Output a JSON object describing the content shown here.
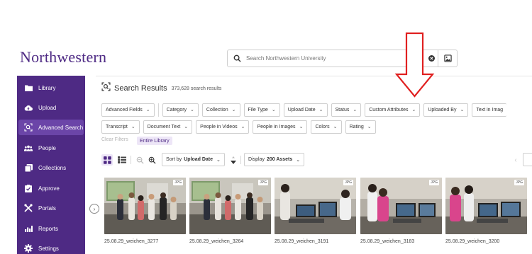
{
  "header": {
    "logo": "Northwestern",
    "search_placeholder": "Search Northwestern University"
  },
  "sidebar": {
    "items": [
      {
        "label": "Library",
        "icon": "folder-icon"
      },
      {
        "label": "Upload",
        "icon": "cloud-upload-icon"
      },
      {
        "label": "Advanced Search",
        "icon": "advanced-search-icon",
        "active": true
      },
      {
        "label": "People",
        "icon": "people-icon"
      },
      {
        "label": "Collections",
        "icon": "collections-icon"
      },
      {
        "label": "Approve",
        "icon": "approve-icon"
      },
      {
        "label": "Portals",
        "icon": "portals-icon"
      },
      {
        "label": "Reports",
        "icon": "reports-icon"
      },
      {
        "label": "Settings",
        "icon": "settings-icon"
      }
    ]
  },
  "results": {
    "title": "Search Results",
    "count": "373,628 search results"
  },
  "filters_row1": [
    "Advanced Fields",
    "Category",
    "Collection",
    "File Type",
    "Upload Date",
    "Status",
    "Custom Attributes",
    "Uploaded By",
    "Text in Imag"
  ],
  "filters_row2": [
    "Transcript",
    "Document Text",
    "People in Videos",
    "People in Images",
    "Colors",
    "Rating"
  ],
  "active_filters": {
    "clear_label": "Clear Filters",
    "chip": "Entire Library"
  },
  "toolbar": {
    "sort_prefix": "Sort by",
    "sort_value": "Upload Date",
    "display_prefix": "Display",
    "display_value": "200 Assets"
  },
  "assets": [
    {
      "name": "25.08.29_weichen_3277",
      "type": "JPG"
    },
    {
      "name": "25.08.29_weichen_3264",
      "type": "JPG"
    },
    {
      "name": "25.08.29_weichen_3191",
      "type": "JPG"
    },
    {
      "name": "25.08.29_weichen_3183",
      "type": "JPG"
    },
    {
      "name": "25.08.29_weichen_3200",
      "type": "JPG"
    }
  ],
  "colors": {
    "brand_purple": "#4e2a84",
    "active_purple": "#6b45a8",
    "annotation_red": "#e02020"
  }
}
